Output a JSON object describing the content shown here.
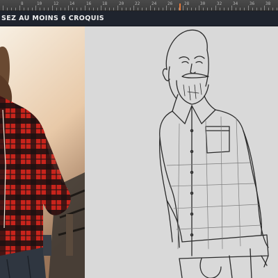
{
  "ruler": {
    "labels": [
      "",
      "8",
      "10",
      "12",
      "14",
      "16",
      "18",
      "20",
      "22",
      "24",
      "26",
      "28",
      "30",
      "32",
      "34",
      "36",
      "38"
    ]
  },
  "banner": {
    "text": "SEZ AU MOINS 6 CROQUIS"
  },
  "canvas": {
    "background_color": "#d9d9d9",
    "reference_photo": "bearded-man-plaid-shirt",
    "sketch": "line-drawing-bearded-man"
  }
}
